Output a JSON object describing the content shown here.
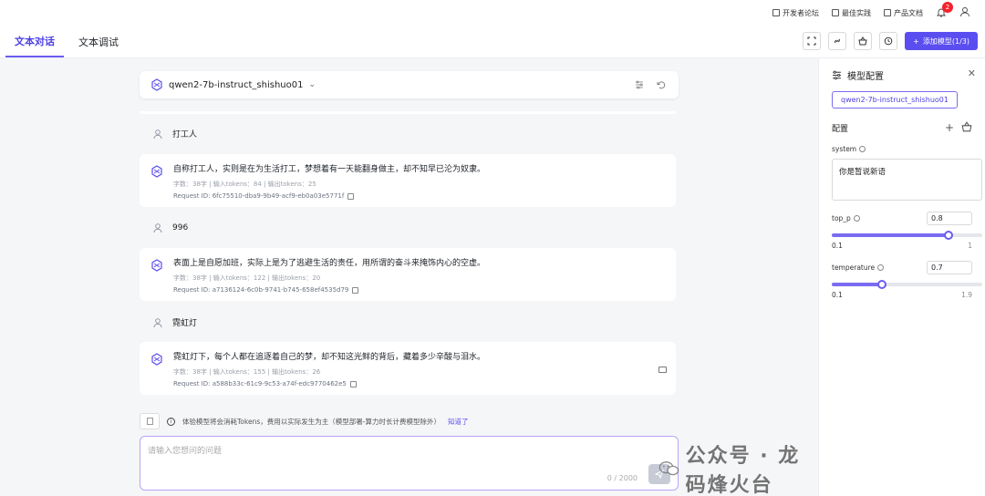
{
  "topbar": {
    "links": [
      "开发者论坛",
      "最佳实践",
      "产品文档"
    ],
    "notification_count": "2"
  },
  "tabs": [
    {
      "label": "文本对话",
      "active": true
    },
    {
      "label": "文本调试",
      "active": false
    }
  ],
  "toolbar": {
    "add_model_label": "添加模型(1/3)"
  },
  "chat": {
    "model_name": "qwen2-7b-instruct_shishuo01",
    "messages": [
      {
        "user": "打工人",
        "reply": "自称打工人，实则是在为生活打工，梦想着有一天能翻身做主，却不知早已沦为奴隶。",
        "meta": "字数：38字 | 输入tokens：84 | 输出tokens：25",
        "request_id": "Request ID: 6fc75510-dba9-9b49-acf9-eb0a03e5771f"
      },
      {
        "user": "996",
        "reply": "表面上是自愿加班，实际上是为了逃避生活的责任，用所谓的奋斗来掩饰内心的空虚。",
        "meta": "字数：38字 | 输入tokens：122 | 输出tokens：20",
        "request_id": "Request ID: a7136124-6c0b-9741-b745-658ef4535d79"
      },
      {
        "user": "霓虹灯",
        "reply": "霓虹灯下，每个人都在追逐着自己的梦，却不知这光鲜的背后，藏着多少辛酸与泪水。",
        "meta": "字数：38字 | 输入tokens：155 | 输出tokens：26",
        "request_id": "Request ID: a588b33c-61c9-9c53-a74f-edc9770462e5"
      }
    ],
    "notice": "体验模型将会消耗Tokens，费用以实际发生为主（模型部署-算力时长计费模型除外）",
    "notice_link": "知道了",
    "input_placeholder": "请输入您想问的问题",
    "counter": "0 / 2000"
  },
  "watermark": "公众号 · 龙码烽火台",
  "panel": {
    "title": "模型配置",
    "model_tag": "qwen2-7b-instruct_shishuo01",
    "config_label": "配置",
    "system_label": "system",
    "system_value": "你是暂说新语",
    "top_p": {
      "label": "top_p",
      "value": "0.8",
      "min": "0.1",
      "max": "1",
      "fraction": 0.778
    },
    "temperature": {
      "label": "temperature",
      "value": "0.7",
      "min": "0.1",
      "max": "1.9",
      "fraction": 0.333
    }
  }
}
